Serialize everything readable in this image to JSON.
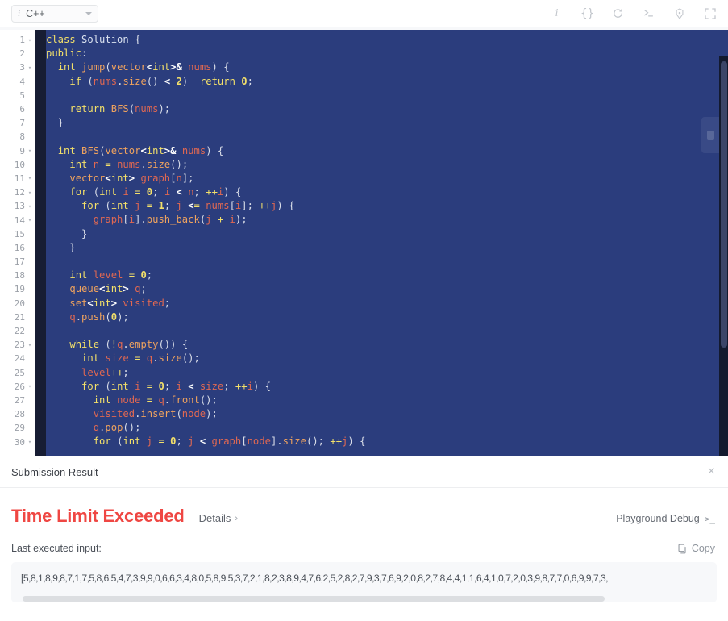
{
  "toolbar": {
    "language": {
      "icon": "info-italic-icon",
      "label": "C++",
      "caret": "chevron-down-icon"
    },
    "icons": [
      {
        "name": "info-icon",
        "glyph": "i"
      },
      {
        "name": "braces-icon",
        "glyph": "{}"
      },
      {
        "name": "reset-icon",
        "glyph": "↺"
      },
      {
        "name": "console-icon",
        "glyph": ">_"
      },
      {
        "name": "settings-icon",
        "glyph": "⚙"
      },
      {
        "name": "fullscreen-icon",
        "glyph": "⛶"
      }
    ]
  },
  "editor": {
    "language": "cpp",
    "first_line": 1,
    "lines": [
      {
        "n": 1,
        "fold": true,
        "text": "class Solution {"
      },
      {
        "n": 2,
        "fold": false,
        "text": "public:"
      },
      {
        "n": 3,
        "fold": true,
        "text": "  int jump(vector<int>& nums) {"
      },
      {
        "n": 4,
        "fold": false,
        "text": "    if (nums.size() < 2)  return 0;"
      },
      {
        "n": 5,
        "fold": false,
        "text": ""
      },
      {
        "n": 6,
        "fold": false,
        "text": "    return BFS(nums);"
      },
      {
        "n": 7,
        "fold": false,
        "text": "  }"
      },
      {
        "n": 8,
        "fold": false,
        "text": ""
      },
      {
        "n": 9,
        "fold": true,
        "text": "  int BFS(vector<int>& nums) {"
      },
      {
        "n": 10,
        "fold": false,
        "text": "    int n = nums.size();"
      },
      {
        "n": 11,
        "fold": true,
        "text": "    vector<int> graph[n];"
      },
      {
        "n": 12,
        "fold": true,
        "text": "    for (int i = 0; i < n; ++i) {"
      },
      {
        "n": 13,
        "fold": true,
        "text": "      for (int j = 1; j <= nums[i]; ++j) {"
      },
      {
        "n": 14,
        "fold": true,
        "text": "        graph[i].push_back(j + i);"
      },
      {
        "n": 15,
        "fold": false,
        "text": "      }"
      },
      {
        "n": 16,
        "fold": false,
        "text": "    }"
      },
      {
        "n": 17,
        "fold": false,
        "text": ""
      },
      {
        "n": 18,
        "fold": false,
        "text": "    int level = 0;"
      },
      {
        "n": 19,
        "fold": false,
        "text": "    queue<int> q;"
      },
      {
        "n": 20,
        "fold": false,
        "text": "    set<int> visited;"
      },
      {
        "n": 21,
        "fold": false,
        "text": "    q.push(0);"
      },
      {
        "n": 22,
        "fold": false,
        "text": ""
      },
      {
        "n": 23,
        "fold": true,
        "text": "    while (!q.empty()) {"
      },
      {
        "n": 24,
        "fold": false,
        "text": "      int size = q.size();"
      },
      {
        "n": 25,
        "fold": false,
        "text": "      level++;"
      },
      {
        "n": 26,
        "fold": true,
        "text": "      for (int i = 0; i < size; ++i) {"
      },
      {
        "n": 27,
        "fold": false,
        "text": "        int node = q.front();"
      },
      {
        "n": 28,
        "fold": false,
        "text": "        visited.insert(node);"
      },
      {
        "n": 29,
        "fold": false,
        "text": "        q.pop();"
      },
      {
        "n": 30,
        "fold": true,
        "text": "        for (int j = 0; j < graph[node].size(); ++j) {"
      }
    ],
    "colors": {
      "background": "#2b3d7d",
      "gutter_background": "#ffffff",
      "gutter_strip": "#171d33",
      "keyword": "#f3e06a",
      "function": "#f0a35e",
      "identifier": "#e06852",
      "punctuation": "#d9dde8",
      "type": "#d9e1ef"
    }
  },
  "result": {
    "header_title": "Submission Result",
    "close_label": "×",
    "verdict": "Time Limit Exceeded",
    "verdict_color": "#ef4743",
    "details_label": "Details",
    "details_chevron": "›",
    "playground_debug_label": "Playground Debug",
    "playground_debug_icon": ">_",
    "last_input_label": "Last executed input:",
    "copy_label": "Copy",
    "input_value": "[5,8,1,8,9,8,7,1,7,5,8,6,5,4,7,3,9,9,0,6,6,3,4,8,0,5,8,9,5,3,7,2,1,8,2,3,8,9,4,7,6,2,5,2,8,2,7,9,3,7,6,9,2,0,8,2,7,8,4,4,1,1,6,4,1,0,7,2,0,3,9,8,7,7,0,6,9,9,7,3,"
  }
}
